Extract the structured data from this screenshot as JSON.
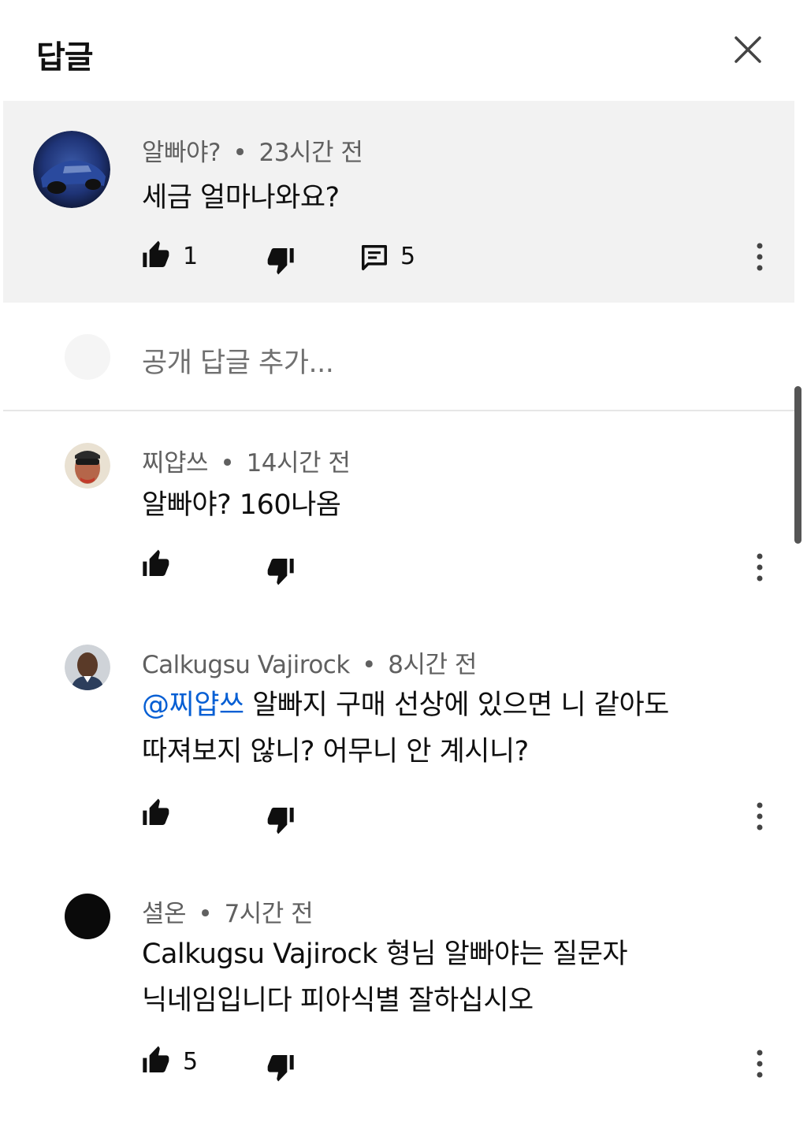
{
  "header": {
    "title": "답글",
    "close_icon": "close-icon"
  },
  "parent": {
    "author": "알빠야?",
    "separator": "•",
    "time": "23시간 전",
    "text": "세금 얼마나와요?",
    "likes": "1",
    "replies": "5",
    "icons": [
      "thumbs-up-icon",
      "thumbs-down-icon",
      "reply-icon",
      "more-vert-icon"
    ]
  },
  "add_reply": {
    "placeholder": "공개 답글 추가..."
  },
  "replies": [
    {
      "author": "찌얍쓰",
      "separator": "•",
      "time": "14시간 전",
      "lines": [
        "알빠야? 160나옴"
      ],
      "likes": ""
    },
    {
      "author": "Calkugsu Vajirock",
      "separator": "•",
      "time": "8시간 전",
      "mention": "@찌얍쓰",
      "line1_rest": " 알빠지 구매 선상에 있으면 니 같아도",
      "line2": "따져보지 않니? 어무니 안 계시니?",
      "likes": ""
    },
    {
      "author": "셜온",
      "separator": "•",
      "time": "7시간 전",
      "lines": [
        "Calkugsu Vajirock 형님 알빠야는 질문자",
        "닉네임입니다 피아식별 잘하십시오"
      ],
      "likes": "5"
    }
  ],
  "colors": {
    "mention": "#065fd4",
    "meta": "#606060",
    "parent_bg": "#f2f2f2"
  }
}
